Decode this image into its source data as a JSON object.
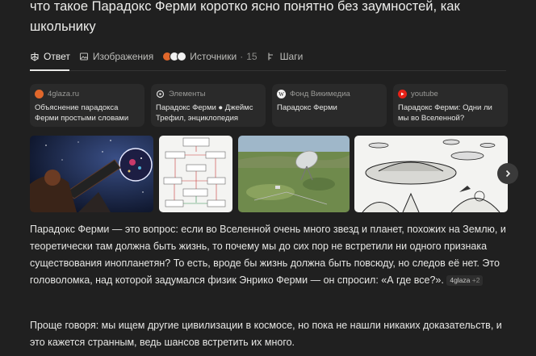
{
  "query": "что такое Парадокс Ферми коротко ясно понятно без заумностей, как школьнику",
  "tabs": {
    "answer": "Ответ",
    "images": "Изображения",
    "sources": "Источники",
    "sources_count": "15",
    "steps": "Шаги"
  },
  "source_cards": [
    {
      "site": "4glaza.ru",
      "title": "Объяснение парадокса Ферми простыми словами",
      "favicon_color": "#e0672b"
    },
    {
      "site": "Элементы",
      "title": "Парадокс Ферми ● Джеймс Трефил, энциклопедия",
      "favicon_color": "#ffffff"
    },
    {
      "site": "Фонд Викимедиа",
      "title": "Парадокс Ферми",
      "favicon_color": "#ffffff"
    },
    {
      "site": "youtube",
      "title": "Парадокс Ферми: Одни ли мы во Вселенной?",
      "favicon_color": "#e62117"
    }
  ],
  "paragraph1": "Парадокс Ферми — это вопрос: если во Вселенной очень много звезд и планет, похожих на Землю, и теоретически там должна быть жизнь, то почему мы до сих пор не встретили ни одного признака существования инопланетян? То есть, вроде бы жизнь должна быть повсюду, но следов её нет. Это головоломка, над которой задумался физик Энрико Ферми — он спросил: «А где все?».",
  "citation": {
    "label": "4glaza",
    "extra": "+2"
  },
  "paragraph2": "Проще говоря: мы ищем другие цивилизации в космосе, но пока не нашли никаких доказательств, и это кажется странным, ведь шансов встретить их много.",
  "icons": {
    "answer": "perplexity-logo-icon",
    "images": "image-icon",
    "steps": "steps-icon",
    "next": "chevron-right-icon"
  }
}
